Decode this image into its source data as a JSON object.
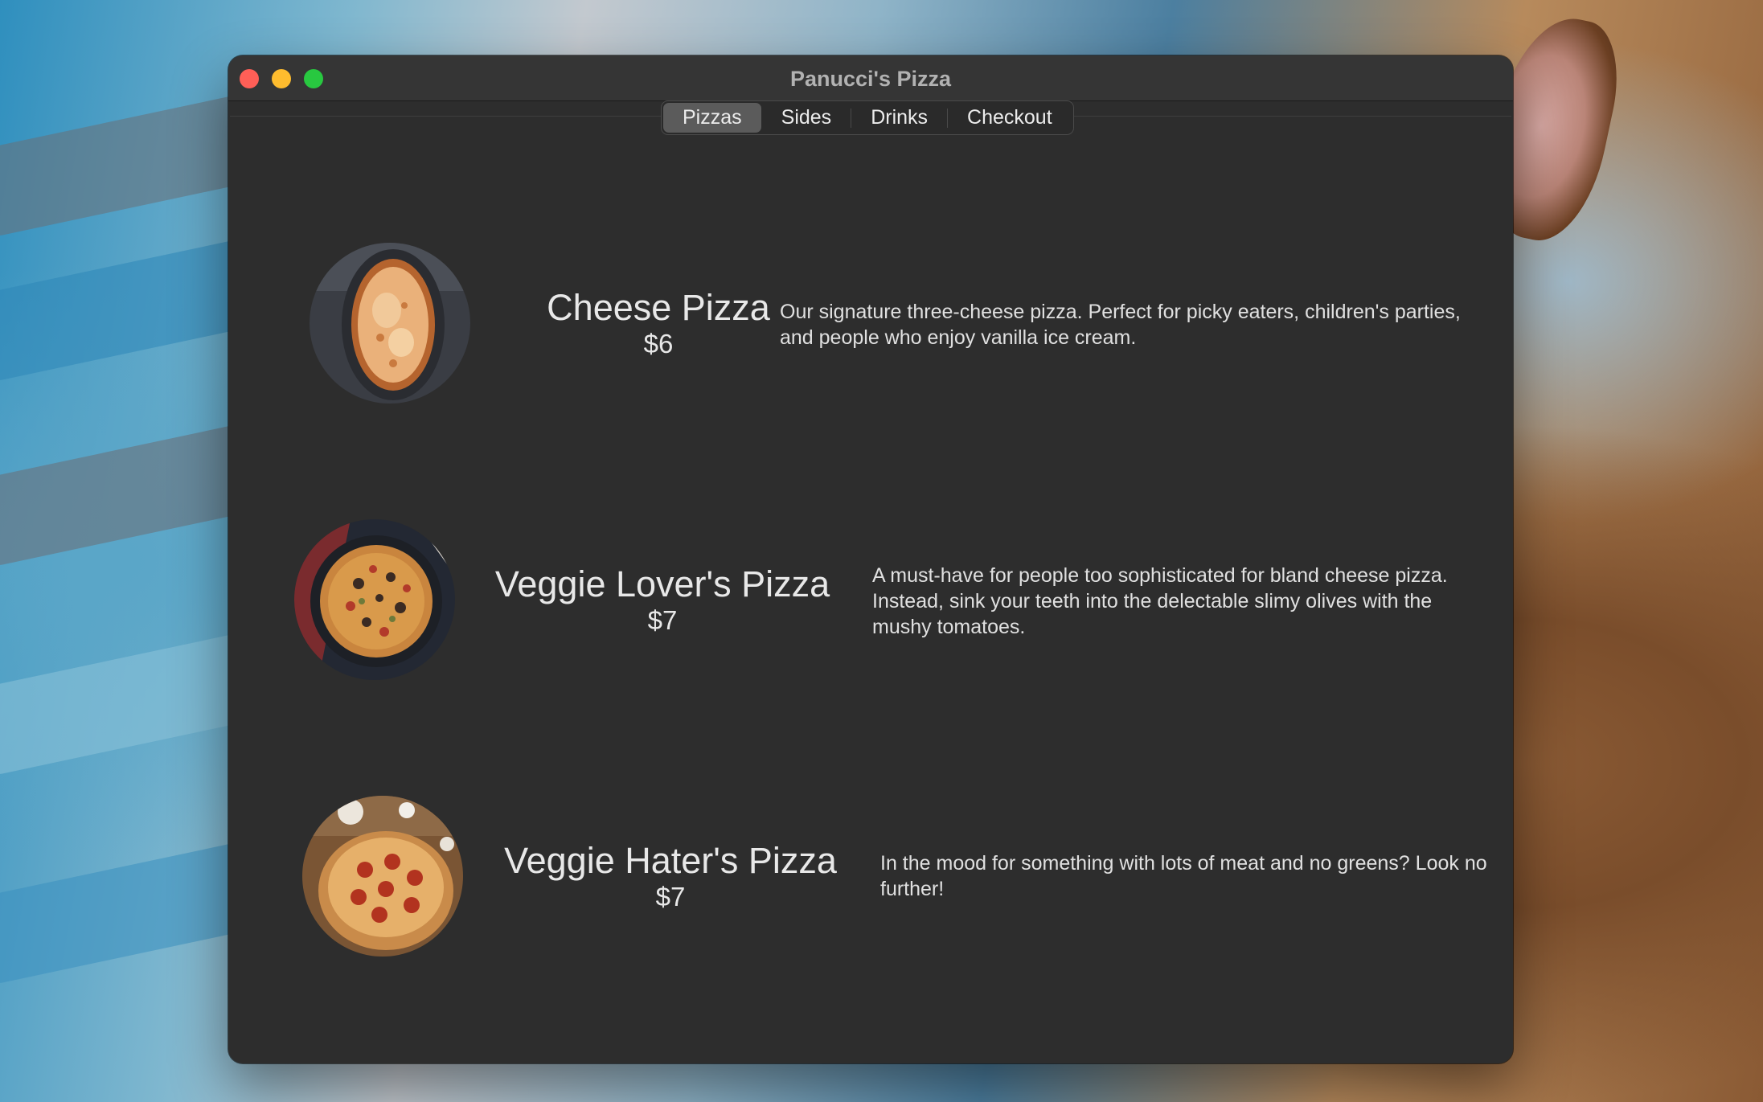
{
  "window": {
    "title": "Panucci's Pizza"
  },
  "tabs": [
    {
      "label": "Pizzas",
      "selected": true
    },
    {
      "label": "Sides",
      "selected": false
    },
    {
      "label": "Drinks",
      "selected": false
    },
    {
      "label": "Checkout",
      "selected": false
    }
  ],
  "menu": {
    "items": [
      {
        "name": "Cheese Pizza",
        "price": "$6",
        "description": "Our signature three-cheese pizza. Perfect for picky eaters, children's parties, and people who enjoy vanilla ice cream.",
        "image": "cheese-pizza-photo"
      },
      {
        "name": "Veggie Lover's Pizza",
        "price": "$7",
        "description": "A must-have for people too sophisticated for bland cheese pizza. Instead, sink your teeth into the delectable slimy olives with the mushy tomatoes.",
        "image": "veggie-pizza-photo"
      },
      {
        "name": "Veggie Hater's Pizza",
        "price": "$7",
        "description": "In the mood for something with lots of meat and no greens? Look no further!",
        "image": "pepperoni-pizza-photo"
      }
    ]
  },
  "colors": {
    "window_bg": "#2d2d2d",
    "titlebar_bg": "#353535",
    "close": "#ff5f57",
    "minimize": "#febc2e",
    "zoom": "#28c840",
    "selected_tab": "#5b5b5b"
  }
}
